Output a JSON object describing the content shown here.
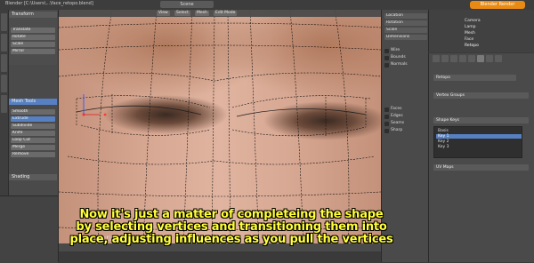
{
  "app": {
    "window_title": "Blender [C:\\Users\\...\\face_retopo.blend]",
    "scene_label": "Scene",
    "render_label": "Blender Render"
  },
  "viewport": {
    "header_items": [
      "View",
      "Select",
      "Mesh",
      "Edit Mode"
    ],
    "last_operator": "Last: Activate Select"
  },
  "tool_shelf": {
    "sections": [
      "Transform",
      "Mesh Tools",
      "Shading"
    ],
    "buttons": [
      "Translate",
      "Rotate",
      "Scale",
      "Mirror",
      "Smooth",
      "Extrude",
      "Subdivide",
      "Knife",
      "Loop Cut",
      "Merge",
      "Remove"
    ],
    "selected_button": "Extrude"
  },
  "properties_panel": {
    "rows": [
      "Location",
      "Rotation",
      "Scale",
      "Dimensions"
    ],
    "checkboxes": [
      "Wire",
      "Bounds",
      "Normals",
      "Faces",
      "Edges",
      "Seams",
      "Sharp"
    ]
  },
  "outliner": {
    "items": [
      "Camera",
      "Lamp",
      "Mesh",
      "Face",
      "Retopo"
    ]
  },
  "property_editor": {
    "object_name": "Retopo",
    "fields": [
      "Vertex Groups",
      "Shape Keys",
      "UV Maps"
    ],
    "list_items": [
      "Basis",
      "Key 1",
      "Key 2",
      "Key 3"
    ],
    "selected_list_item": "Key 1"
  },
  "subtitle": {
    "lines": [
      "Now it's just a matter of completeing the shape",
      "by selecting vertices and transitioning them into",
      "place, adjusting influences as you pull the vertices"
    ]
  },
  "colors": {
    "accent_selection": "#5680c2",
    "render_button": "#e98a14",
    "subtitle_text": "#ffff3a"
  }
}
